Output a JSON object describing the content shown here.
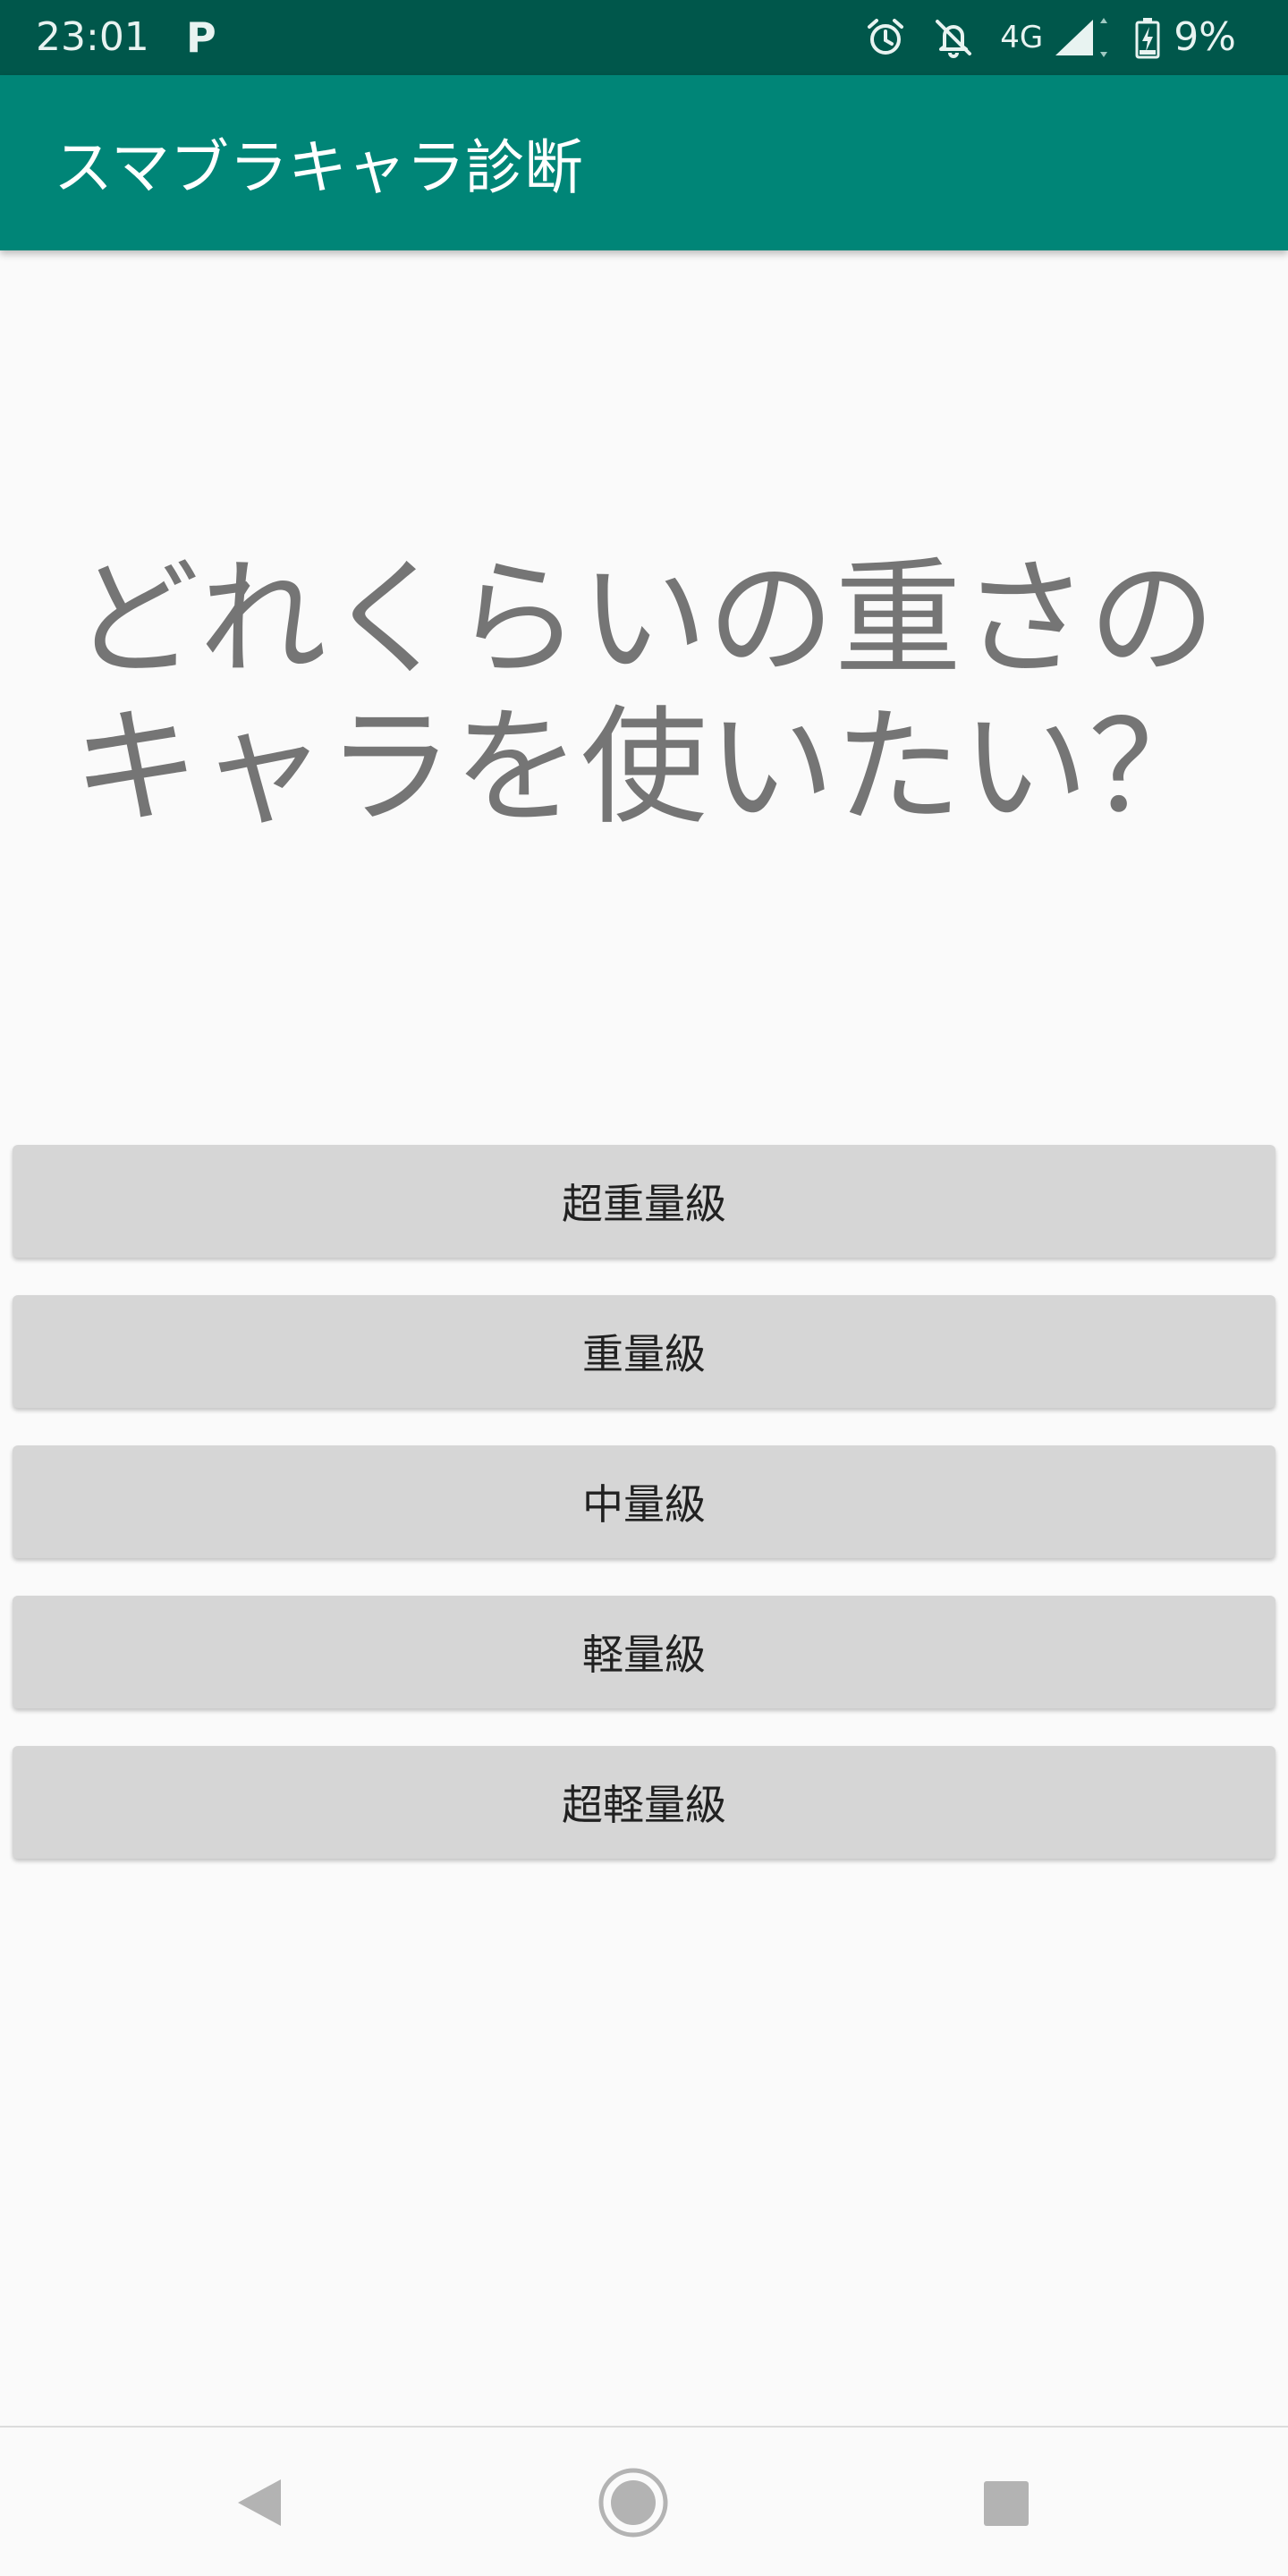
{
  "status_bar": {
    "time": "23:01",
    "notification_letter": "P",
    "network": "4G",
    "battery": "9%",
    "icons": [
      "alarm-icon",
      "notifications-off-icon",
      "signal-icon",
      "battery-charging-icon"
    ]
  },
  "app_bar": {
    "title": "スマブラキャラ診断"
  },
  "question": {
    "line1": "どれくらいの重さの",
    "line2": "キャラを使いたい？"
  },
  "options": [
    {
      "label": "超重量級"
    },
    {
      "label": "重量級"
    },
    {
      "label": "中量級"
    },
    {
      "label": "軽量級"
    },
    {
      "label": "超軽量級"
    }
  ],
  "nav_bar": {
    "icons": [
      "back-icon",
      "home-icon",
      "recents-icon"
    ]
  },
  "colors": {
    "status_bar": "#00574b",
    "app_bar": "#008577",
    "button": "#d6d6d6",
    "question_text": "#757575",
    "background": "#fafafa"
  }
}
